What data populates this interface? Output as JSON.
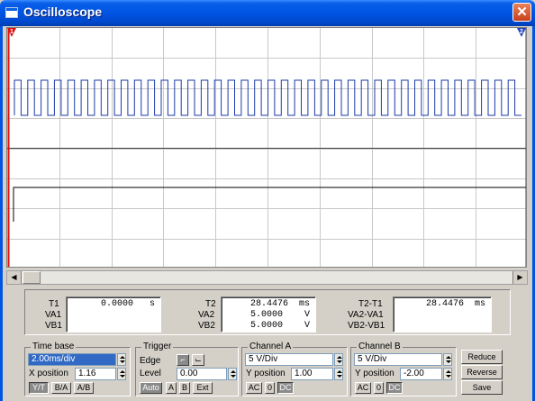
{
  "window": {
    "title": "Oscilloscope",
    "close": "✕"
  },
  "screen": {
    "cursor1": "1",
    "cursor2": "2",
    "grid": true,
    "channel_a": {
      "color": "#1e3aa8",
      "type": "square-wave",
      "cycles": 38
    },
    "channel_b": {
      "color": "#000000",
      "type": "step"
    }
  },
  "readouts": {
    "t1": {
      "label": "T1",
      "value": "0.0000   s"
    },
    "va1": {
      "label": "VA1",
      "value": ""
    },
    "vb1": {
      "label": "VB1",
      "value": ""
    },
    "t2": {
      "label": "T2",
      "value": "28.4476  ms"
    },
    "va2": {
      "label": "VA2",
      "value": "5.0000    V"
    },
    "vb2": {
      "label": "VB2",
      "value": "5.0000    V"
    },
    "dt": {
      "label": "T2-T1",
      "value": "28.4476  ms"
    },
    "dva": {
      "label": "VA2-VA1",
      "value": ""
    },
    "dvb": {
      "label": "VB2-VB1",
      "value": ""
    }
  },
  "time_base": {
    "title": "Time base",
    "value": "2.00ms/div",
    "xpos_label": "X position",
    "xpos": "1.16",
    "modes": [
      "Y/T",
      "B/A",
      "A/B"
    ]
  },
  "trigger": {
    "title": "Trigger",
    "edge_label": "Edge",
    "edge_rise": "⌐",
    "edge_fall": "⌙",
    "level_label": "Level",
    "level": "0.00",
    "sources": [
      "Auto",
      "A",
      "B",
      "Ext"
    ]
  },
  "channel_a": {
    "title": "Channel A",
    "volts": "5 V/Div",
    "ypos_label": "Y position",
    "ypos": "1.00",
    "coupling": [
      "AC",
      "0",
      "DC"
    ]
  },
  "channel_b": {
    "title": "Channel B",
    "volts": "5 V/Div",
    "ypos_label": "Y position",
    "ypos": "-2.00",
    "coupling": [
      "AC",
      "0",
      "DC"
    ]
  },
  "buttons": {
    "reduce": "Reduce",
    "reverse": "Reverse",
    "save": "Save"
  }
}
